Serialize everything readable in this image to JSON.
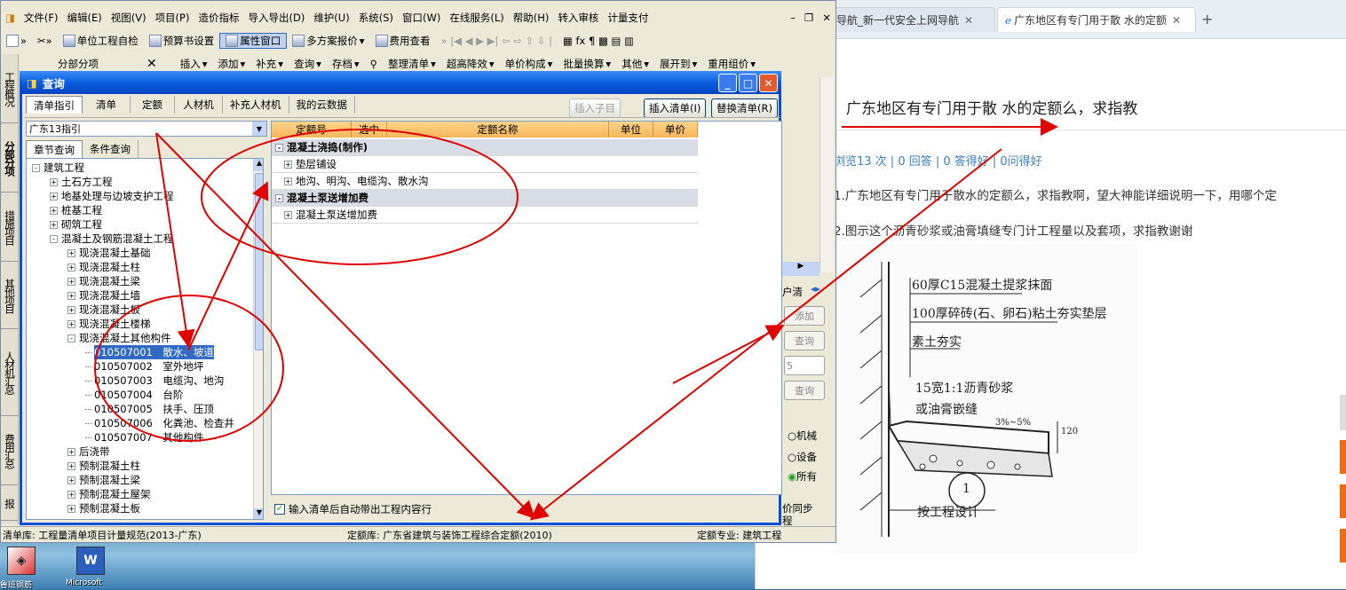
{
  "desktop": {
    "icons": [
      {
        "label": "鲁班钢筋",
        "icon": "app-icon"
      },
      {
        "label": "Microsoft",
        "icon": "word-icon"
      }
    ]
  },
  "browser": {
    "tabs": [
      {
        "label": "导航_新一代安全上网导航",
        "active": false
      },
      {
        "label": "广东地区有专门用于散 水的定额",
        "active": true
      }
    ],
    "new_tab": "+",
    "question": {
      "title": "广东地区有专门用于散 水的定额么，求指教",
      "stats": "浏览13 次 | 0 回答 | 0 答得好 | 0问得好",
      "line1": "1.广东地区有专门用于散水的定额么，求指教啊，望大神能详细说明一下，用哪个定",
      "line2": "2.图示这个沥青砂浆或油膏填缝专门计工程量以及套项，求指教谢谢"
    },
    "sketch": {
      "t1": "60厚C15混凝土提浆抹面",
      "t2": "100厚碎砖(石、卵石)粘土夯实垫层",
      "t3": "素土夯实",
      "t4": "15宽1:1沥青砂浆",
      "t5": "或油膏嵌缝",
      "t6": "3%~5%",
      "t7": "120",
      "t8": "按工程设计",
      "circle": "1"
    }
  },
  "app": {
    "menu": [
      "文件(F)",
      "编辑(E)",
      "视图(V)",
      "项目(P)",
      "造价指标",
      "导入导出(D)",
      "维护(U)",
      "系统(S)",
      "窗口(W)",
      "在线服务(L)",
      "帮助(H)",
      "转入审核",
      "计量支付"
    ],
    "toolbar1": [
      "单位工程自检",
      "预算书设置",
      "属性窗口",
      "多方案报价",
      "费用查看"
    ],
    "panel_title": "分部分项",
    "toolbar2": [
      "插入",
      "添加",
      "补充",
      "查询",
      "存档",
      "整理清单",
      "超高降效",
      "单价构成",
      "批量换算",
      "其他",
      "展开到",
      "重用组价"
    ],
    "leftnav": [
      "工程概况",
      "分部分项",
      "措施项目",
      "其他项目",
      "人材机汇总",
      "费用汇总",
      "报"
    ],
    "right_panel": {
      "label": "户清",
      "buttons": [
        "添加",
        "查询",
        "5",
        "查询"
      ],
      "radios": [
        "机械",
        "设备",
        "所有"
      ],
      "sync": "价同步",
      "sync2": "程"
    },
    "status": {
      "list_lib": "清单库: 工程量清单项目计量规范(2013-广东)",
      "quota_lib": "定额库: 广东省建筑与装饰工程综合定额(2010)",
      "quota_major": "定额专业: 建筑工程"
    }
  },
  "dialog": {
    "title": "查询",
    "tabs": [
      "清单指引",
      "清单",
      "定额",
      "人材机",
      "补充人材机",
      "我的云数据"
    ],
    "btn_insert_child": "插入子目",
    "btn_insert_list": "插入清单(I)",
    "btn_replace_list": "替换清单(R)",
    "combo_value": "广东13指引",
    "subtabs": [
      "章节查询",
      "条件查询"
    ],
    "tree": [
      {
        "lvl": 0,
        "pm": "-",
        "text": "建筑工程"
      },
      {
        "lvl": 1,
        "pm": "+",
        "text": "土石方工程"
      },
      {
        "lvl": 1,
        "pm": "+",
        "text": "地基处理与边坡支护工程"
      },
      {
        "lvl": 1,
        "pm": "+",
        "text": "桩基工程"
      },
      {
        "lvl": 1,
        "pm": "+",
        "text": "砌筑工程"
      },
      {
        "lvl": 1,
        "pm": "-",
        "text": "混凝土及钢筋混凝土工程"
      },
      {
        "lvl": 2,
        "pm": "+",
        "text": "现浇混凝土基础"
      },
      {
        "lvl": 2,
        "pm": "+",
        "text": "现浇混凝土柱"
      },
      {
        "lvl": 2,
        "pm": "+",
        "text": "现浇混凝土梁"
      },
      {
        "lvl": 2,
        "pm": "+",
        "text": "现浇混凝土墙"
      },
      {
        "lvl": 2,
        "pm": "+",
        "text": "现浇混凝土板"
      },
      {
        "lvl": 2,
        "pm": "+",
        "text": "现浇混凝土楼梯"
      },
      {
        "lvl": 2,
        "pm": "-",
        "text": "现浇混凝土其他构件"
      },
      {
        "lvl": 3,
        "pm": "",
        "text": "010507001　散水、坡道",
        "sel": true
      },
      {
        "lvl": 3,
        "pm": "",
        "text": "010507002　室外地坪"
      },
      {
        "lvl": 3,
        "pm": "",
        "text": "010507003　电缆沟、地沟"
      },
      {
        "lvl": 3,
        "pm": "",
        "text": "010507004　台阶"
      },
      {
        "lvl": 3,
        "pm": "",
        "text": "010507005　扶手、压顶"
      },
      {
        "lvl": 3,
        "pm": "",
        "text": "010507006　化粪池、检查井"
      },
      {
        "lvl": 3,
        "pm": "",
        "text": "010507007　其他构件"
      },
      {
        "lvl": 2,
        "pm": "+",
        "text": "后浇带"
      },
      {
        "lvl": 2,
        "pm": "+",
        "text": "预制混凝土柱"
      },
      {
        "lvl": 2,
        "pm": "+",
        "text": "预制混凝土梁"
      },
      {
        "lvl": 2,
        "pm": "+",
        "text": "预制混凝土屋架"
      },
      {
        "lvl": 2,
        "pm": "+",
        "text": "预制混凝土板"
      }
    ],
    "grid_headers": [
      "定额号",
      "选中",
      "定额名称",
      "单位",
      "单价"
    ],
    "grid_rows": [
      {
        "type": "group",
        "pm": "-",
        "text": "混凝土浇捣(制作)"
      },
      {
        "type": "item",
        "pm": "+",
        "text": "垫层铺设"
      },
      {
        "type": "item",
        "pm": "+",
        "text": "地沟、明沟、电缆沟、散水沟"
      },
      {
        "type": "group",
        "pm": "-",
        "text": "混凝土泵送增加费"
      },
      {
        "type": "item",
        "pm": "+",
        "text": "混凝土泵送增加费"
      }
    ],
    "checkbox_label": "输入清单后自动带出工程内容行",
    "checkbox_checked": true
  },
  "colors": {
    "title_bar": "#0a5ee0",
    "annotation": "#e00000",
    "grid_header": "#f6b65a",
    "link": "#3a7fc4"
  }
}
